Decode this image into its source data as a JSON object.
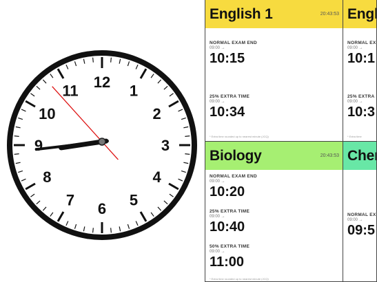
{
  "clock": {
    "numbers": [
      "12",
      "1",
      "2",
      "3",
      "4",
      "5",
      "6",
      "7",
      "8",
      "9",
      "10",
      "11"
    ],
    "time": {
      "hour": 8,
      "minute": 43,
      "second": 53
    }
  },
  "panels": [
    {
      "title": "English 1",
      "clock": "20:43:53",
      "color": "#f7db3f",
      "rows": [
        {
          "label": "NORMAL EXAM END",
          "start": "09:00 →",
          "time": "10:15"
        },
        {
          "label": "25% EXTRA TIME",
          "start": "09:00 →",
          "time": "10:34"
        }
      ],
      "note": "* Extra time rounded up to nearest minute (JCQ)"
    },
    {
      "title": "Engl",
      "color": "#f7db3f",
      "rows": [
        {
          "label": "NORMAL EX",
          "start": "09:00 →",
          "time": "10:1"
        },
        {
          "label": "25% EXTRA",
          "start": "09:00 →",
          "time": "10:3"
        }
      ],
      "note": "* Extra time"
    },
    {
      "title": "Biology",
      "clock": "20:43:53",
      "color": "#a6ef72",
      "rows": [
        {
          "label": "NORMAL EXAM END",
          "start": "09:00 →",
          "time": "10:20"
        },
        {
          "label": "25% EXTRA TIME",
          "start": "09:00 →",
          "time": "10:40"
        },
        {
          "label": "50% EXTRA TIME",
          "start": "09:00 →",
          "time": "11:00"
        }
      ],
      "note": "* Extra time rounded up to nearest minute (JCQ)"
    },
    {
      "title": "Cher",
      "color": "#68e7a6",
      "rows": [
        {
          "label": "NORMAL EX",
          "start": "09:00 →",
          "time": "09:5"
        }
      ]
    }
  ]
}
